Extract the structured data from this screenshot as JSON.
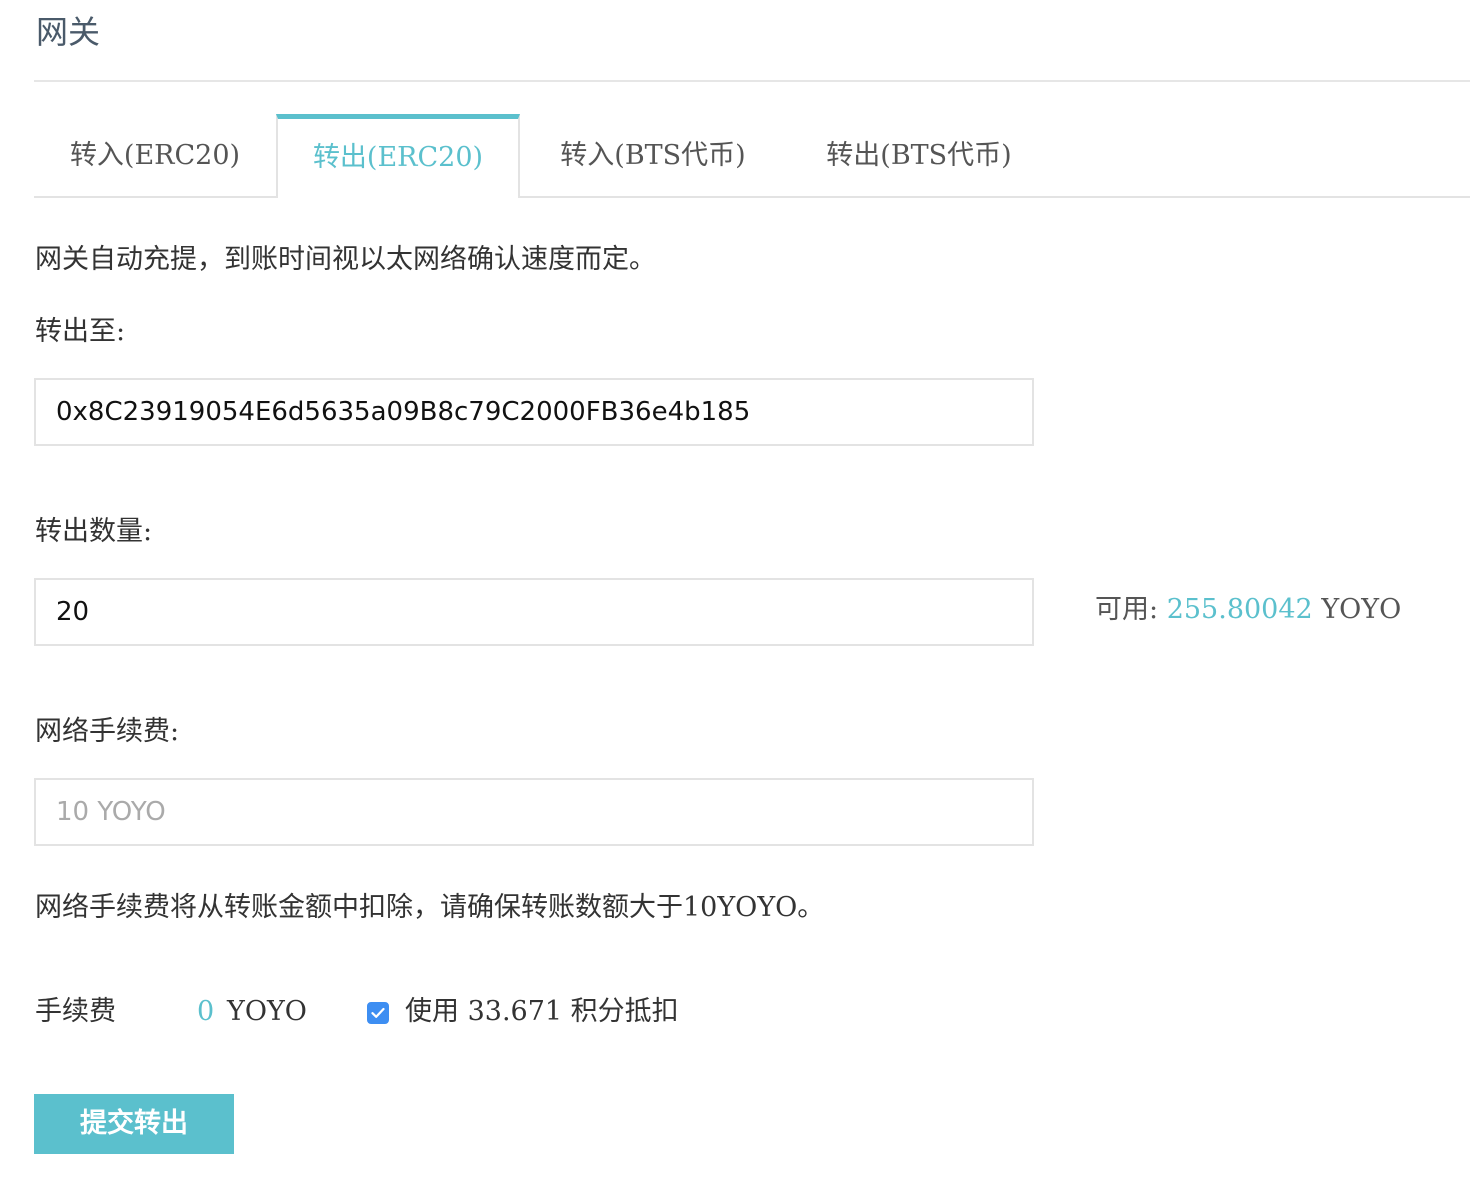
{
  "page": {
    "title": "网关"
  },
  "tabs": [
    {
      "label": "转入(ERC20)",
      "active": false
    },
    {
      "label": "转出(ERC20)",
      "active": true
    },
    {
      "label": "转入(BTS代币)",
      "active": false
    },
    {
      "label": "转出(BTS代币)",
      "active": false
    }
  ],
  "form": {
    "info_text": "网关自动充提，到账时间视以太网络确认速度而定。",
    "address_label": "转出至:",
    "address_value": "0x8C23919054E6d5635a09B8c79C2000FB36e4b185",
    "amount_label": "转出数量:",
    "amount_value": "20",
    "available_label": "可用:",
    "available_amount": "255.80042",
    "available_unit": "YOYO",
    "network_fee_label": "网络手续费:",
    "network_fee_placeholder": "10 YOYO",
    "network_fee_note": "网络手续费将从转账金额中扣除，请确保转账数额大于10YOYO。",
    "fee_label": "手续费",
    "fee_value": "0",
    "fee_unit": "YOYO",
    "points_checkbox_checked": true,
    "points_text": "使用 33.671 积分抵扣",
    "submit_label": "提交转出"
  },
  "colors": {
    "accent": "#5bc0cd",
    "checkbox": "#3d8ef2",
    "border": "#e3e3e3",
    "title": "#4a5a6a"
  }
}
